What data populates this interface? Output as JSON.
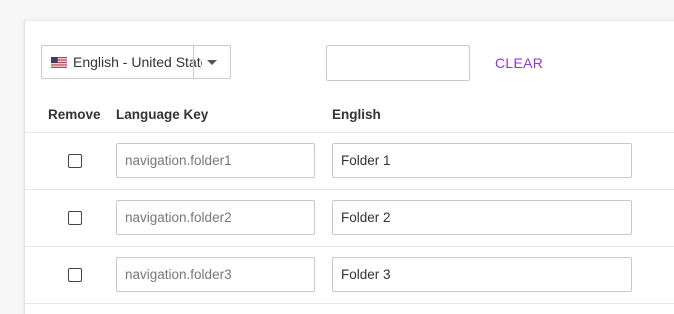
{
  "toolbar": {
    "language_select": {
      "value": "English - United States",
      "flag_icon": "us-flag-icon"
    },
    "filter": {
      "value": "",
      "placeholder": ""
    },
    "clear_label": "CLEAR",
    "accent_color": "#9b30d9"
  },
  "table": {
    "columns": {
      "remove": "Remove",
      "key": "Language Key",
      "value": "English"
    },
    "rows": [
      {
        "key": "navigation.folder1",
        "value": "Folder 1",
        "checked": false
      },
      {
        "key": "navigation.folder2",
        "value": "Folder 2",
        "checked": false
      },
      {
        "key": "navigation.folder3",
        "value": "Folder 3",
        "checked": false
      }
    ]
  }
}
